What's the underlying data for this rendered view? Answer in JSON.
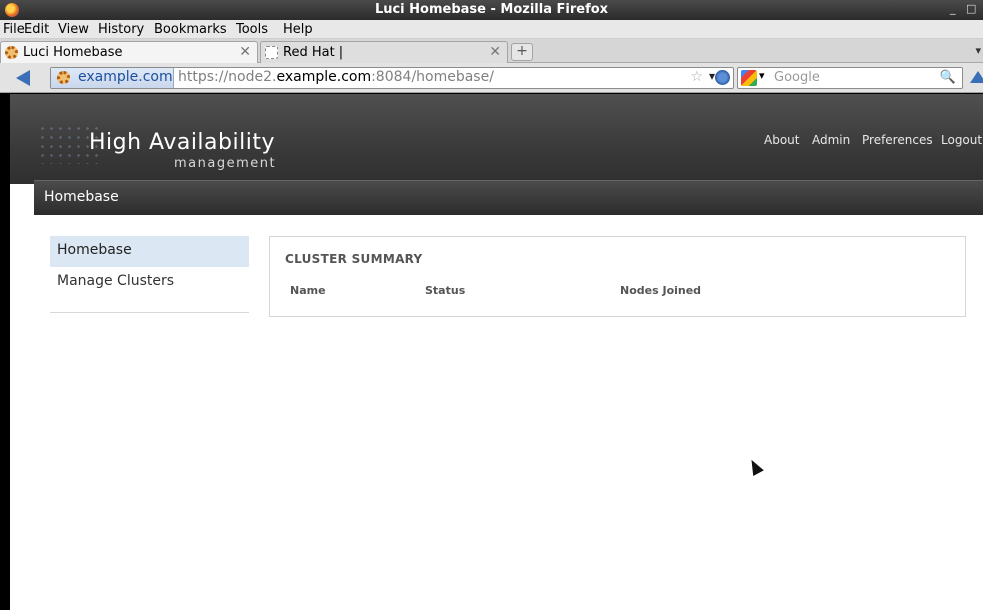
{
  "window": {
    "title": "Luci Homebase - Mozilla Firefox",
    "minimize": "_",
    "maximize": "□"
  },
  "menu": [
    "File",
    "Edit",
    "View",
    "History",
    "Bookmarks",
    "Tools",
    "Help"
  ],
  "tabs": [
    {
      "label": "Luci Homebase",
      "active": true,
      "favicon": "gear-icon"
    },
    {
      "label": "Red Hat |",
      "active": false,
      "favicon": "blank-page-icon"
    }
  ],
  "newtab_symbol": "+",
  "tab_scroll_symbol": "▾",
  "nav": {
    "site_identity": "example.com",
    "url_prefix": "https://node2.",
    "url_host": "example.com",
    "url_suffix": ":8084/homebase/",
    "star": "☆",
    "dropdown": "▾",
    "search_placeholder": "Google",
    "search_engine_dropdown": "▾",
    "search_button": "🔍"
  },
  "app": {
    "brand": "High Availability",
    "brand_sub": "management",
    "links": [
      "About",
      "Admin",
      "Preferences",
      "Logout"
    ],
    "breadcrumb": "Homebase"
  },
  "sidebar": {
    "items": [
      {
        "label": "Homebase",
        "active": true
      },
      {
        "label": "Manage Clusters",
        "active": false
      }
    ]
  },
  "summary": {
    "title": "CLUSTER SUMMARY",
    "columns": [
      "Name",
      "Status",
      "Nodes Joined"
    ]
  },
  "colors": {
    "accent": "#3a6fb7",
    "header": "#3a3a3a",
    "sidebar_active": "#dbe8f3"
  }
}
